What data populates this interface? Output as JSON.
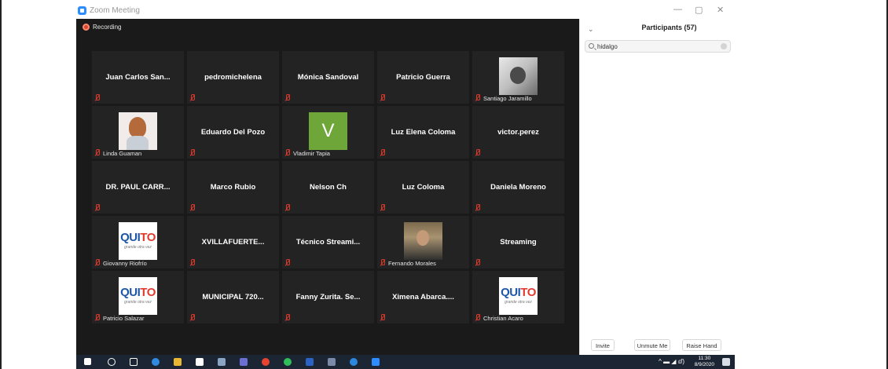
{
  "window": {
    "title": "Zoom Meeting",
    "minimize": "—",
    "maximize": "▢",
    "close": "✕"
  },
  "recording": {
    "label": "Recording",
    "color": "#d8452c"
  },
  "tiles": [
    {
      "name": "Juan Carlos San...",
      "kind": "name"
    },
    {
      "name": "pedromichelena",
      "kind": "name"
    },
    {
      "name": "Mónica Sandoval",
      "kind": "name"
    },
    {
      "name": "Patricio Guerra",
      "kind": "name"
    },
    {
      "label": "Santiago Jaramillo",
      "kind": "photo-sj"
    },
    {
      "label": "Linda Guaman",
      "kind": "photo-lg"
    },
    {
      "name": "Eduardo Del Pozo",
      "kind": "name"
    },
    {
      "label": "Vladimir Tapia",
      "kind": "avatar-v",
      "initial": "V"
    },
    {
      "name": "Luz Elena Coloma",
      "kind": "name"
    },
    {
      "name": "victor.perez",
      "kind": "name"
    },
    {
      "name": "DR. PAUL CARR...",
      "kind": "name"
    },
    {
      "name": "Marco Rubio",
      "kind": "name"
    },
    {
      "name": "Nelson Ch",
      "kind": "name"
    },
    {
      "name": "Luz Coloma",
      "kind": "name"
    },
    {
      "name": "Daniela Moreno",
      "kind": "name"
    },
    {
      "label": "Giovanny Riofrío",
      "kind": "quito"
    },
    {
      "name": "XVILLAFUERTE...",
      "kind": "name"
    },
    {
      "name": "Técnico Streami...",
      "kind": "name"
    },
    {
      "label": "Fernando Morales",
      "kind": "photo-fm"
    },
    {
      "name": "Streaming",
      "kind": "name"
    },
    {
      "label": "Patricio Salazar",
      "kind": "quito"
    },
    {
      "name": "MUNICIPAL 720...",
      "kind": "name"
    },
    {
      "name": "Fanny Zurita. Se...",
      "kind": "name"
    },
    {
      "name": "Ximena Abarca....",
      "kind": "name"
    },
    {
      "label": "Christian Acaro",
      "kind": "quito"
    }
  ],
  "quito_logo": {
    "text1": "QUI",
    "text2": "TO",
    "tagline": "grande otra vez"
  },
  "participants_panel": {
    "title": "Participants (57)",
    "search_value": "hidalgo",
    "buttons": [
      "Invite",
      "Unmute Me",
      "Raise Hand"
    ]
  },
  "taskbar": {
    "time": "11:30",
    "date": "8/9/2020",
    "sys_icons": "^  ▬ ◢ ⅆ)"
  },
  "colors": {
    "video_bg": "#1a1a1a",
    "tile_bg": "#232323",
    "muted_red": "#d93a2c",
    "accent_blue": "#2d8cff",
    "avatar_green": "#6fa63a"
  }
}
